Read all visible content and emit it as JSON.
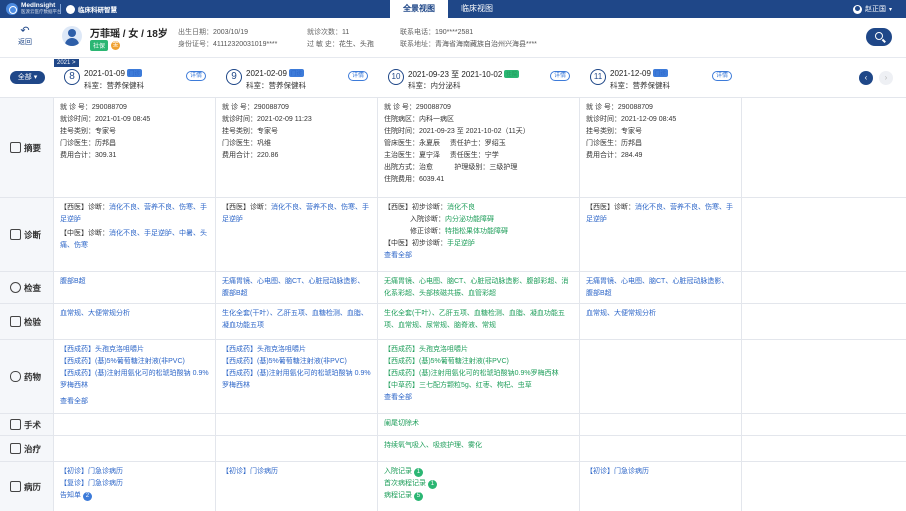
{
  "header": {
    "logo1_line1": "MedInsight",
    "logo1_line2": "医渡云医疗数据平台",
    "logo2": "临床科研智慧",
    "tabs": [
      "全景视图",
      "临床视图"
    ],
    "user": "赵正国"
  },
  "patient": {
    "back": "返回",
    "name": "万菲瑶 / 女 / 18岁",
    "badge": "社保",
    "badge2": "金",
    "birth_k": "出生日期：",
    "birth": "2003/10/19",
    "id_k": "身份证号：",
    "id": "4111232003101​9****",
    "visits_k": "就诊次数：",
    "visits": "11",
    "allergy_k": "过 敏 史：",
    "allergy": "花生、头孢",
    "phone_k": "联系电话：",
    "phone": "190****2581",
    "addr_k": "联系地址：",
    "addr": "青海省海南藏族自治州兴海县****"
  },
  "timeline": {
    "year": "2021 >",
    "all": "全部 ▾",
    "prev": "‹",
    "next": "›",
    "detail": "详情"
  },
  "visits": [
    {
      "num": "8",
      "date": "2021-01-09",
      "tag": "门诊",
      "tagcolor": "blue",
      "dept": "科室：营养保健科"
    },
    {
      "num": "9",
      "date": "2021-02-09",
      "tag": "门诊",
      "tagcolor": "blue",
      "dept": "科室：营养保健科"
    },
    {
      "num": "10",
      "date": "2021-09-23 至 2021-10-02",
      "tag": "住院",
      "tagcolor": "green",
      "dept": "科室：内分泌科"
    },
    {
      "num": "11",
      "date": "2021-12-09",
      "tag": "门诊",
      "tagcolor": "blue",
      "dept": "科室：营养保健科"
    }
  ],
  "rows": {
    "summary": "摘要",
    "diagnosis": "诊断",
    "exam": "检查",
    "test": "检验",
    "drug": "药物",
    "surgery": "手术",
    "treatment": "治疗",
    "record": "病历"
  },
  "summary": [
    [
      "就 诊 号：290088709",
      "就诊时间：2021-01-09 08:45",
      "挂号类别：专家号",
      "门诊医生：历邦昌",
      "费用合计：309.31"
    ],
    [
      "就 诊 号：290088709",
      "就诊时间：2021-02-09 11:23",
      "挂号类别：专家号",
      "门诊医生：巩维",
      "费用合计：220.86"
    ],
    [
      "就 诊 号：290088709",
      "住院病区：内科一病区",
      "住院时间：2021-09-23 至 2021-10-02（11天）",
      "管床医生：永夏辰",
      "主治医生：夏宁泽",
      "出院方式：治愈",
      "住院费用：6039.41"
    ],
    [
      "就 诊 号：290088709",
      "就诊时间：2021-12-09 08:45",
      "挂号类别：专家号",
      "门诊医生：历邦昌",
      "费用合计：284.49"
    ]
  ],
  "summary_extra": {
    "nurse": "责任护士：罗绍玉",
    "lead": "责任医生：宁学",
    "care": "护理级别：三级护理"
  },
  "diagnosis": {
    "c1_west_k": "【西医】诊断：",
    "c1_west": "消化不良、营养不良、伤寒、手足逆胪",
    "c1_cn_k": "【中医】诊断：",
    "c1_cn": "消化不良、手足逆胪、中暑、头痛、伤寒",
    "c2_west_k": "【西医】诊断：",
    "c2_west": "消化不良、营养不良、伤寒、手足逆胪",
    "c3_west_k": "【西医】初步诊断：",
    "c3_west": "消化不良",
    "c3_in_k": "入院诊断：",
    "c3_in": "内分泌功能障碍",
    "c3_fix_k": "修正诊断：",
    "c3_fix": "特指松果体功能障碍",
    "c3_cn_k": "【中医】初步诊断：",
    "c3_cn": "手足逆胪",
    "c3_more": "查看全部",
    "c4_west_k": "【西医】诊断：",
    "c4_west": "消化不良、营养不良、伤寒、手足逆胪"
  },
  "exam": [
    "腹部B超",
    "无痛胃镜、心电图、脑CT、心脏冠动脉造影、腹部B超",
    "无痛胃镜、心电图、脑CT、心脏冠动脉造影、腹部彩超、消化系彩超、头部核磁共振、血管彩超",
    "无痛胃镜、心电图、脑CT、心脏冠动脉造影、腹部B超"
  ],
  "test": [
    "血常规、大便常规分析",
    "生化全套(干叶）、乙肝五项、血糖检测、血脂、凝血功能五项",
    "生化全套(干叶）、乙肝五项、血糖检测、血脂、凝血功能五项、血常规、尿常规、脑脊液、常规",
    "血常规、大便常规分析"
  ],
  "drug": {
    "c1": [
      "【西成药】头孢克洛咀嚼片",
      "【西成药】(基)5%葡萄糖注射液(非PVC)",
      "【西成药】(基)注射用氨化可的松琥珀酸钠 0.9%罗梅西林"
    ],
    "c1_more": "查看全部",
    "c2": [
      "【西成药】头孢克洛咀嚼片",
      "【西成药】(基)5%葡萄糖注射液(非PVC)",
      "【西成药】(基)注射用氨化可的松琥珀酸钠 0.9%罗梅西林"
    ],
    "c3": [
      "【西成药】头孢克洛咀嚼片",
      "【西成药】(基)5%葡萄糖注射液(非PVC)",
      "【西成药】(基)注射用氨化可的松琥珀酸钠0.9%罗梅西林",
      "【中草药】三七配方颗粒5g、红枣、枸杞、虫草"
    ],
    "c3_more": "查看全部"
  },
  "surgery": {
    "c3": "阑尾切除术"
  },
  "treatment": {
    "c3": "持续氧气吸入、吸痰护理、雾化"
  },
  "record": {
    "c1": [
      "【初诊】门急诊病历",
      "【复诊】门急诊病历",
      "告知单"
    ],
    "c1_badge": "2",
    "c2": "【初诊】门诊病历",
    "c3": [
      "入院记录",
      "首次病程记录",
      "病程记录"
    ],
    "c3_badges": [
      "1",
      "1",
      "5"
    ],
    "c4": "【初诊】门急诊病历"
  }
}
